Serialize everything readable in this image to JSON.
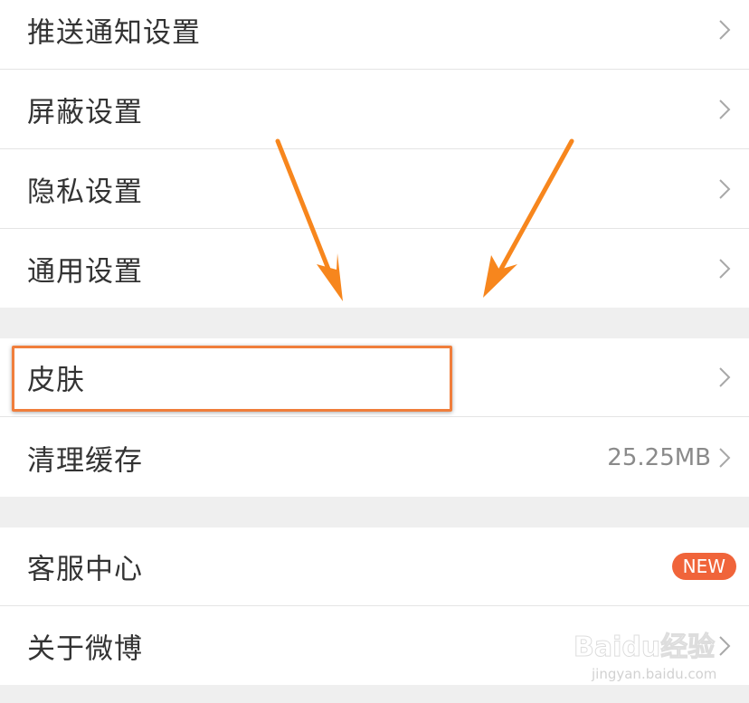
{
  "settings": {
    "group1": [
      {
        "label": "推送通知设置"
      },
      {
        "label": "屏蔽设置"
      },
      {
        "label": "隐私设置"
      },
      {
        "label": "通用设置"
      }
    ],
    "group2": [
      {
        "label": "皮肤"
      },
      {
        "label": "清理缓存",
        "value": "25.25MB"
      }
    ],
    "group3": [
      {
        "label": "客服中心",
        "badge": "NEW"
      },
      {
        "label": "关于微博"
      }
    ]
  },
  "watermark": {
    "brand": "Baidu经验",
    "url": "jingyan.baidu.com"
  },
  "colors": {
    "accent": "#f07e3c",
    "badge": "#f0643a",
    "separator_bg": "#efefef"
  }
}
